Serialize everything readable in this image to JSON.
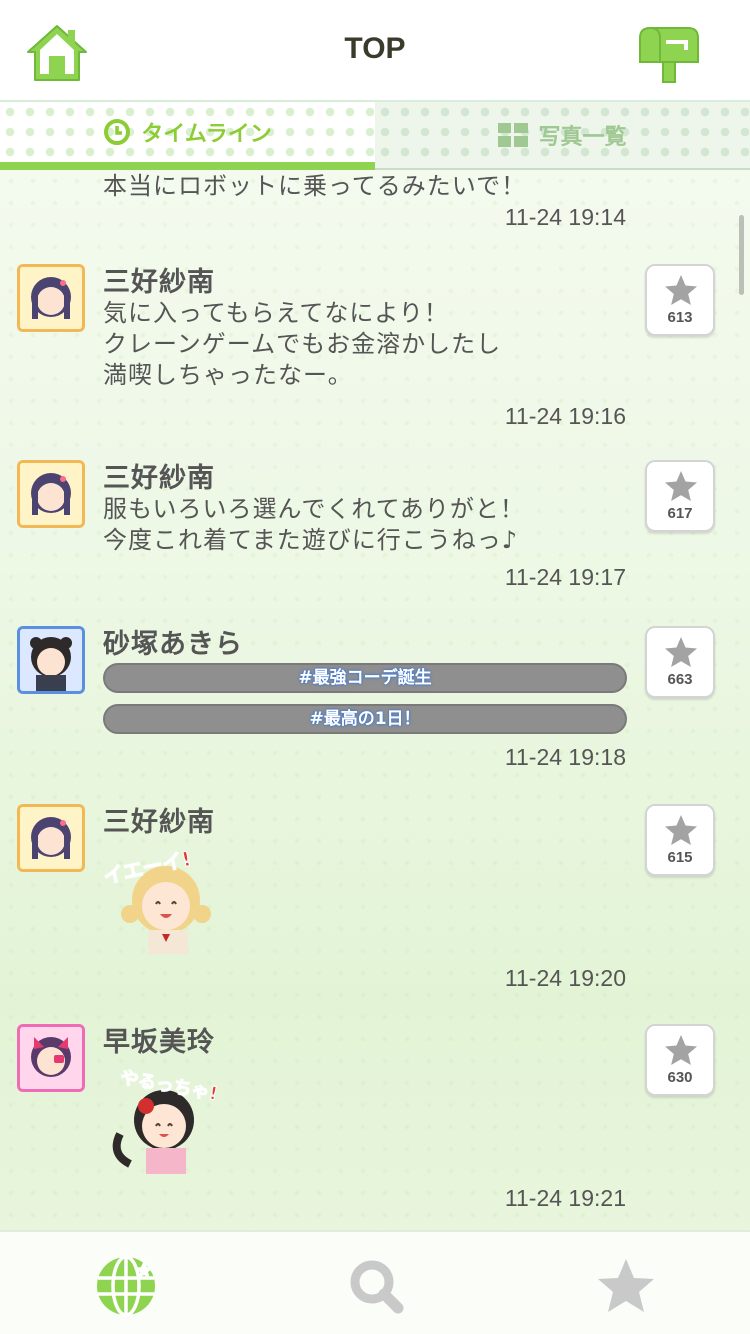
{
  "header": {
    "title": "TOP",
    "home_icon": "home-icon",
    "mail_icon": "mailbox-icon",
    "accent_color": "#8ed450"
  },
  "tabs": [
    {
      "label": "タイムライン",
      "icon": "clock-icon",
      "active": true
    },
    {
      "label": "写真一覧",
      "icon": "grid-icon",
      "active": false
    }
  ],
  "feed": {
    "partial_post": {
      "text": "本当にロボットに乗ってるみたいで！",
      "time": "11-24 19:14"
    },
    "posts": [
      {
        "name": "三好紗南",
        "lines": "気に入ってもらえてなにより！\nクレーンゲームでもお金溶かしたし\n満喫しちゃったなー。",
        "likes": "613",
        "time": "11-24 19:16"
      },
      {
        "name": "三好紗南",
        "lines": "服もいろいろ選んでくれてありがと！\n今度これ着てまた遊びに行こうねっ♪",
        "likes": "617",
        "time": "11-24 19:17"
      },
      {
        "name": "砂塚あきら",
        "hashtags": [
          "#最強コーデ誕生",
          "#最高の1日！"
        ],
        "likes": "663",
        "time": "11-24 19:18"
      },
      {
        "name": "三好紗南",
        "sticker_text": "イエーイ!",
        "likes": "615",
        "time": "11-24 19:20"
      },
      {
        "name": "早坂美玲",
        "sticker_text": "やるっちゃ!",
        "likes": "630",
        "time": "11-24 19:21"
      }
    ]
  },
  "bottom_nav": [
    {
      "icon": "globe-icon",
      "active": true
    },
    {
      "icon": "search-icon",
      "active": false
    },
    {
      "icon": "star-icon",
      "active": false
    }
  ]
}
